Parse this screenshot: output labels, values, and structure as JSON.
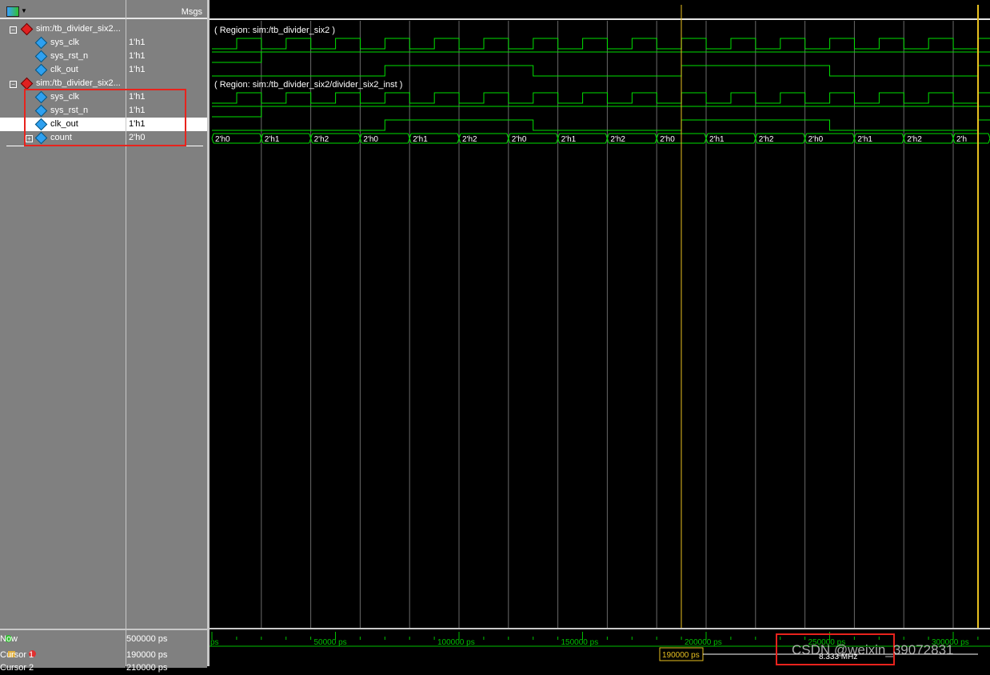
{
  "header": {
    "msgs_label": "Msgs"
  },
  "signals": [
    {
      "name": "sim:/tb_divider_six2...",
      "value": "",
      "type": "group"
    },
    {
      "name": "sys_clk",
      "value": "1'h1",
      "type": "signal"
    },
    {
      "name": "sys_rst_n",
      "value": "1'h1",
      "type": "signal"
    },
    {
      "name": "clk_out",
      "value": "1'h1",
      "type": "signal"
    },
    {
      "name": "sim:/tb_divider_six2...",
      "value": "",
      "type": "group"
    },
    {
      "name": "sys_clk",
      "value": "1'h1",
      "type": "signal"
    },
    {
      "name": "sys_rst_n",
      "value": "1'h1",
      "type": "signal"
    },
    {
      "name": "clk_out",
      "value": "1'h1",
      "type": "signal",
      "selected": true
    },
    {
      "name": "count",
      "value": "2'h0",
      "type": "bus"
    }
  ],
  "regions": {
    "r1": "( Region: sim:/tb_divider_six2 )",
    "r2": "( Region: sim:/tb_divider_six2/divider_six2_inst )"
  },
  "count_bus_values": [
    "2'h0",
    "2'h1",
    "2'h2",
    "2'h0",
    "2'h1",
    "2'h2",
    "2'h0",
    "2'h1",
    "2'h2",
    "2'h0",
    "2'h1",
    "2'h2",
    "2'h0",
    "2'h1",
    "2'h2",
    "2'h"
  ],
  "footer": {
    "now_label": "Now",
    "now_value": "500000 ps",
    "cursor1_label": "Cursor 1",
    "cursor1_value": "190000 ps",
    "cursor2_label": "Cursor 2",
    "cursor2_value": "210000 ps",
    "cursor_flag": "190000 ps",
    "freq_label": "8.333 MHz"
  },
  "timeline": {
    "tick_labels": [
      "ps",
      "50000 ps",
      "100000 ps",
      "150000 ps",
      "200000 ps",
      "250000 ps",
      "300000 ps"
    ]
  },
  "watermark": "CSDN @weixin_39072831",
  "colors": {
    "wave": "#00e000",
    "cursor": "#e8c020",
    "annotation_box": "#e8231d"
  }
}
